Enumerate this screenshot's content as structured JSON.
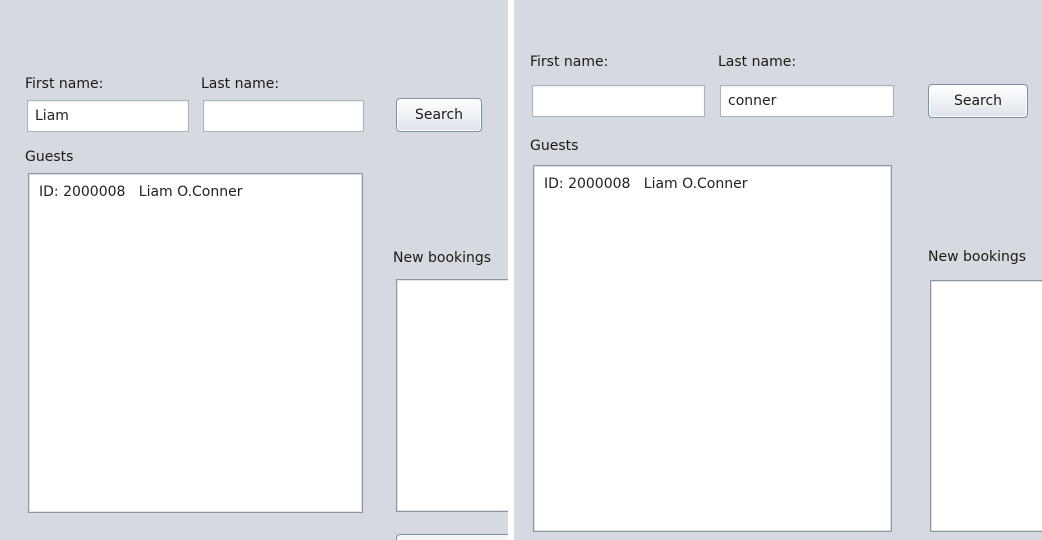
{
  "left_panel": {
    "first_name_label": "First name:",
    "last_name_label": "Last name:",
    "first_name_value": "Liam",
    "last_name_value": "",
    "search_label": "Search",
    "guests_label": "Guests",
    "guests": [
      "ID: 2000008   Liam O.Conner"
    ],
    "new_bookings_label": "New bookings"
  },
  "right_panel": {
    "first_name_label": "First name:",
    "last_name_label": "Last name:",
    "first_name_value": "",
    "last_name_value": "conner",
    "search_label": "Search",
    "guests_label": "Guests",
    "guests": [
      "ID: 2000008   Liam O.Conner"
    ],
    "new_bookings_label": "New bookings"
  }
}
